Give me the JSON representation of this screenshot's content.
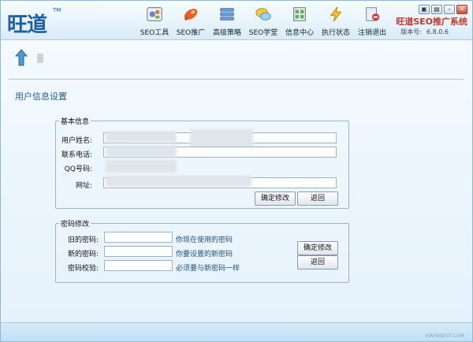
{
  "app": {
    "logo_text": "旺道",
    "logo_tm": "TM",
    "brand": "旺道SEO推广系统",
    "version_label": "版本号:",
    "version_value": "6.8.0.6"
  },
  "window_controls": [
    "▣",
    "▤",
    "–",
    "✕"
  ],
  "nav": [
    {
      "label": "SEO工具",
      "icon": "gear-tools-icon"
    },
    {
      "label": "SEO推广",
      "icon": "rocket-icon"
    },
    {
      "label": "高级策略",
      "icon": "server-stack-icon"
    },
    {
      "label": "SEO学堂",
      "icon": "chat-bubbles-icon"
    },
    {
      "label": "信息中心",
      "icon": "document-grid-icon"
    },
    {
      "label": "执行状态",
      "icon": "lightning-icon"
    },
    {
      "label": "注销退出",
      "icon": "logout-icon"
    }
  ],
  "page_title": "用户信息设置",
  "basic": {
    "legend": "基本信息",
    "name_label": "用户姓名:",
    "phone_label": "联系电话:",
    "qq_label": "QQ号码:",
    "url_label": "网址:",
    "confirm_label": "确定修改",
    "back_label": "返回"
  },
  "password": {
    "legend": "密码修改",
    "old_label": "旧的密码:",
    "new_label": "新的密码:",
    "verify_label": "密码校验:",
    "old_hint": "你现在使用的密码",
    "new_hint": "你要设置的新密码",
    "verify_hint": "必须要与新密码一样",
    "confirm_label": "确定修改",
    "back_label": "返回"
  },
  "watermark": "XIAFANDOT.COM",
  "colors": {
    "accent": "#1f5f9f",
    "brand": "#c0392b",
    "hint": "#1e4f86"
  }
}
